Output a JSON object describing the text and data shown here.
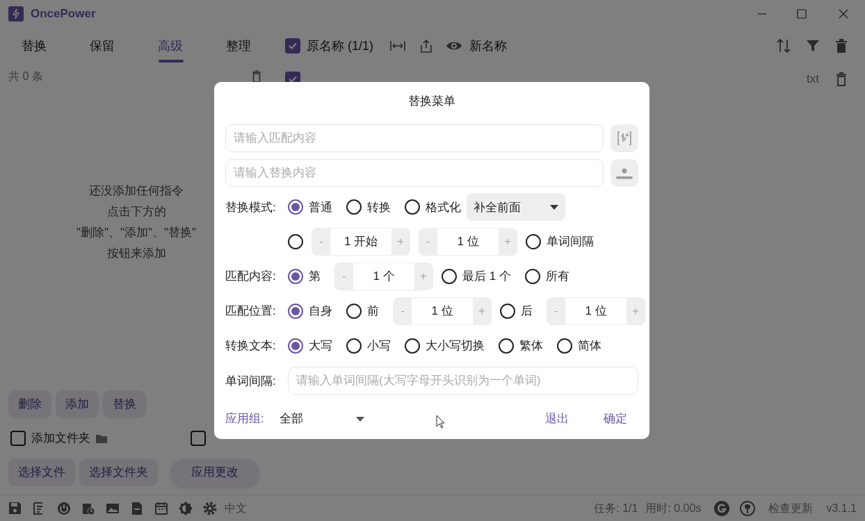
{
  "window": {
    "title": "OncePower"
  },
  "tabs": [
    {
      "label": "替换",
      "selected": false
    },
    {
      "label": "保留",
      "selected": false
    },
    {
      "label": "高级",
      "selected": true
    },
    {
      "label": "整理",
      "selected": false
    }
  ],
  "left_panel": {
    "count": "共 0 条",
    "empty_message": [
      "还没添加任何指令",
      "点击下方的",
      "\"删除\"、\"添加\"、\"替换\"",
      "按钮来添加"
    ],
    "command_buttons": [
      "删除",
      "添加",
      "替换"
    ],
    "checkboxes": [
      {
        "label": "添加文件夹",
        "checked": false,
        "kind": "folder"
      },
      {
        "checked": false,
        "kind": "plain"
      }
    ],
    "action_buttons": [
      {
        "label": "选择文件",
        "kind": "square"
      },
      {
        "label": "选择文件夹",
        "kind": "square"
      },
      {
        "label": "应用更改",
        "kind": "pill"
      }
    ]
  },
  "file_list": {
    "original_header": {
      "label": "原名称 (1/1)",
      "checked": true
    },
    "new_header": "新名称",
    "rows": [
      {
        "checked": true,
        "extension": "txt"
      }
    ]
  },
  "status_bar": {
    "language": "中文",
    "tasks": "任务: 1/1",
    "time": "用时: 0.00s",
    "update": "检查更新",
    "version": "v3.1.1"
  },
  "dialog": {
    "title": "替换菜单",
    "match_field": {
      "placeholder": "请输入匹配内容"
    },
    "replace_field": {
      "placeholder": "请输入替换内容"
    },
    "rows": [
      {
        "label": "替换模式:",
        "items": [
          {
            "kind": "radio",
            "label": "普通",
            "selected": true
          },
          {
            "kind": "radio",
            "label": "转换",
            "selected": false
          },
          {
            "kind": "radio",
            "label": "格式化",
            "selected": false
          },
          {
            "kind": "dropdown",
            "value": "补全前面"
          }
        ]
      },
      {
        "items": [
          {
            "kind": "radio",
            "selected": false
          },
          {
            "kind": "stepper",
            "value": "1 开始",
            "minus": "-",
            "plus": "+"
          },
          {
            "kind": "stepper",
            "value": "1 位",
            "minus": "-",
            "plus": "+"
          },
          {
            "kind": "radio",
            "label": "单词间隔",
            "selected": false
          }
        ]
      },
      {
        "label": "匹配内容:",
        "items": [
          {
            "kind": "radio",
            "label": "第",
            "selected": true
          },
          {
            "kind": "stepper",
            "value": "1 个",
            "minus": "-",
            "plus": "+"
          },
          {
            "kind": "radio",
            "label": "最后 1 个",
            "selected": false
          },
          {
            "kind": "radio",
            "label": "所有",
            "selected": false
          }
        ]
      },
      {
        "label": "匹配位置:",
        "items": [
          {
            "kind": "radio",
            "label": "自身",
            "selected": true
          },
          {
            "kind": "radio",
            "label": "前",
            "selected": false
          },
          {
            "kind": "stepper",
            "value": "1 位",
            "minus": "-",
            "plus": "+"
          },
          {
            "kind": "radio",
            "label": "后",
            "selected": false
          },
          {
            "kind": "stepper",
            "value": "1 位",
            "minus": "-",
            "plus": "+"
          }
        ]
      },
      {
        "label": "转换文本:",
        "items": [
          {
            "kind": "radio",
            "label": "大写",
            "selected": true
          },
          {
            "kind": "radio",
            "label": "小写",
            "selected": false
          },
          {
            "kind": "radio",
            "label": "大小写切换",
            "selected": false
          },
          {
            "kind": "radio",
            "label": "繁体",
            "selected": false
          },
          {
            "kind": "radio",
            "label": "简体",
            "selected": false
          }
        ]
      }
    ],
    "word_gap": {
      "label": "单词间隔:",
      "placeholder": "请输入单词间隔(大写字母开头识别为一个单词)"
    },
    "apply_group": {
      "label": "应用组:",
      "value": "全部"
    },
    "buttons": [
      "退出",
      "确定"
    ]
  }
}
